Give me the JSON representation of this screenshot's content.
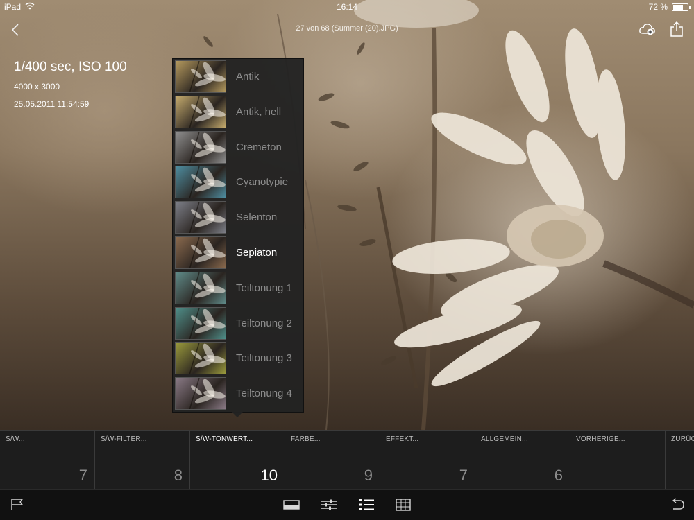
{
  "status_bar": {
    "device": "iPad",
    "time": "16:14",
    "battery": "72 %",
    "battery_level": 0.72,
    "icons": [
      "wifi-icon",
      "battery-icon"
    ]
  },
  "header": {
    "file_title": "27 von 68 (Summer (20).JPG)",
    "icons": [
      "back-chevron-icon",
      "cloud-add-icon",
      "share-icon"
    ]
  },
  "metadata": {
    "exposure": "1/400 sec, ISO 100",
    "dimensions": "4000 x 3000",
    "datetime": "25.05.2011 11:54:59"
  },
  "presets": {
    "selected": "Sepiaton",
    "items": [
      {
        "label": "Antik",
        "tint": "#b59a5e"
      },
      {
        "label": "Antik, hell",
        "tint": "#c4aa6d"
      },
      {
        "label": "Cremeton",
        "tint": "#8f8f8f"
      },
      {
        "label": "Cyanotypie",
        "tint": "#4e8da0"
      },
      {
        "label": "Selenton",
        "tint": "#7d7f88"
      },
      {
        "label": "Sepiaton",
        "tint": "#8a6a4e"
      },
      {
        "label": "Teiltonung 1",
        "tint": "#5f8a88"
      },
      {
        "label": "Teiltonung 2",
        "tint": "#4f8f8a"
      },
      {
        "label": "Teiltonung 3",
        "tint": "#9a9a3c"
      },
      {
        "label": "Teiltonung 4",
        "tint": "#8a7a86"
      }
    ]
  },
  "categories": [
    {
      "name": "S/W...",
      "count": "7"
    },
    {
      "name": "S/W-FILTER...",
      "count": "8"
    },
    {
      "name": "S/W-TONWERT...",
      "count": "10",
      "active": true
    },
    {
      "name": "FARBE...",
      "count": "9"
    },
    {
      "name": "EFFEKT...",
      "count": "7"
    },
    {
      "name": "ALLGEMEIN...",
      "count": "6"
    },
    {
      "name": "VORHERIGE...",
      "count": ""
    },
    {
      "name": "ZURÜC",
      "count": ""
    }
  ],
  "toolbar": {
    "icons": [
      "flag-icon",
      "crop-icon",
      "adjustments-icon",
      "presets-list-icon",
      "grid-icon",
      "undo-icon"
    ]
  }
}
